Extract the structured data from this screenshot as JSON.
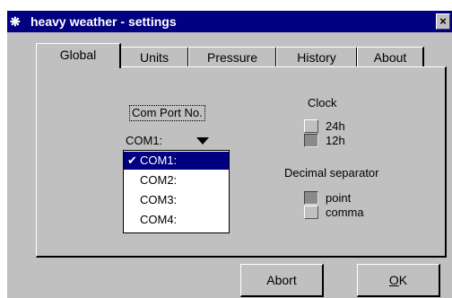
{
  "window": {
    "title": "heavy weather - settings",
    "close_label": "×"
  },
  "tabs": [
    {
      "label": "Global"
    },
    {
      "label": "Units"
    },
    {
      "label": "Pressure"
    },
    {
      "label": "History"
    },
    {
      "label": "About"
    }
  ],
  "comport": {
    "label": "Com Port No.",
    "selected": "COM1:",
    "options": [
      "COM1:",
      "COM2:",
      "COM3:",
      "COM4:"
    ],
    "check_mark": "✔"
  },
  "clock": {
    "label": "Clock",
    "options": [
      "24h",
      "12h"
    ],
    "selected": "12h"
  },
  "decimal": {
    "label": "Decimal separator",
    "options": [
      "point",
      "comma"
    ],
    "selected": "point"
  },
  "buttons": {
    "abort": "Abort",
    "ok_mnemonic": "O",
    "ok_rest": "K"
  }
}
